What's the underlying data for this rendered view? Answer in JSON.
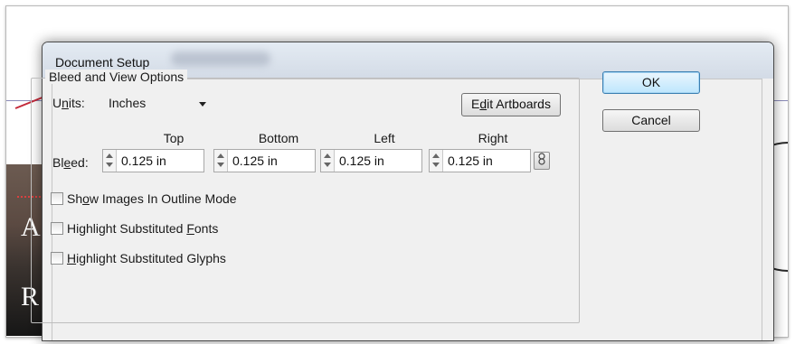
{
  "dialog": {
    "title": "Document Setup"
  },
  "group": {
    "legend": "Bleed and View Options"
  },
  "units": {
    "label_pre": "U",
    "label_mn": "n",
    "label_post": "its:",
    "value": "Inches"
  },
  "buttons": {
    "ok": "OK",
    "cancel": "Cancel",
    "edit_artboards_pre": "E",
    "edit_artboards_mn": "d",
    "edit_artboards_post": "it Artboards"
  },
  "bleed": {
    "label_pre": "Bl",
    "label_mn": "e",
    "label_post": "ed:",
    "columns": [
      "Top",
      "Bottom",
      "Left",
      "Right"
    ],
    "values": [
      "0.125 in",
      "0.125 in",
      "0.125 in",
      "0.125 in"
    ],
    "link_icon": "chain-link-icon"
  },
  "checkboxes": [
    {
      "pre": "Sh",
      "mn": "o",
      "post": "w Images In Outline Mode",
      "checked": false
    },
    {
      "pre": "Highlight Substituted ",
      "mn": "F",
      "post": "onts",
      "checked": false
    },
    {
      "pre": "",
      "mn": "H",
      "post": "ighlight Substituted Glyphs",
      "checked": false
    }
  ],
  "background": {
    "glyph_a": "A",
    "glyph_r": "R"
  }
}
